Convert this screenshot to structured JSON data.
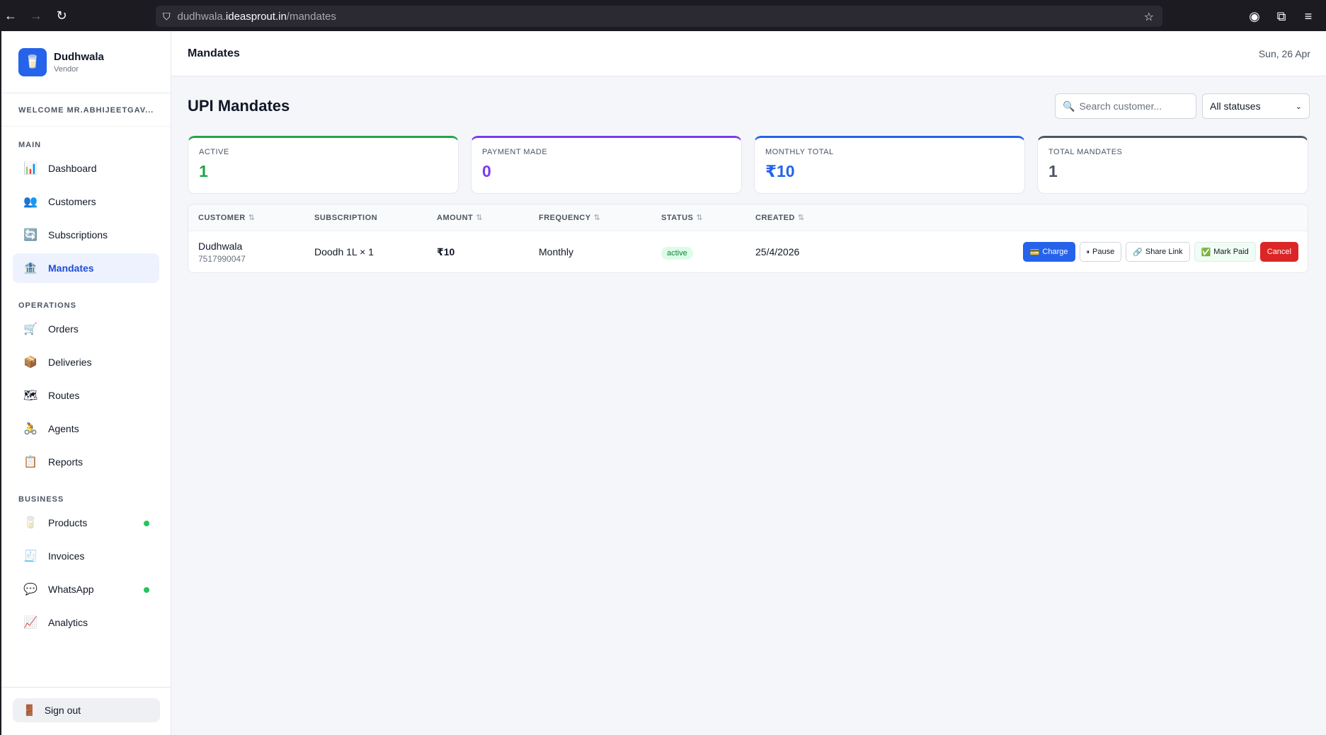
{
  "browser": {
    "url_host_prefix": "dudhwala.",
    "url_host_main": "ideasprout.in",
    "url_path": "/mandates"
  },
  "sidebar": {
    "brand_name": "Dudhwala",
    "brand_role": "Vendor",
    "welcome": "WELCOME MR.ABHIJEETGAV...",
    "sections": {
      "main": "MAIN",
      "operations": "OPERATIONS",
      "business": "BUSINESS"
    },
    "main_items": [
      {
        "label": "Dashboard",
        "icon": "📊"
      },
      {
        "label": "Customers",
        "icon": "👥"
      },
      {
        "label": "Subscriptions",
        "icon": "🔄"
      },
      {
        "label": "Mandates",
        "icon": "🏦"
      }
    ],
    "operations_items": [
      {
        "label": "Orders",
        "icon": "🛒"
      },
      {
        "label": "Deliveries",
        "icon": "📦"
      },
      {
        "label": "Routes",
        "icon": "🗺"
      },
      {
        "label": "Agents",
        "icon": "🚴"
      },
      {
        "label": "Reports",
        "icon": "📋"
      }
    ],
    "business_items": [
      {
        "label": "Products",
        "icon": "🥛"
      },
      {
        "label": "Invoices",
        "icon": "🧾"
      },
      {
        "label": "WhatsApp",
        "icon": "💬"
      },
      {
        "label": "Analytics",
        "icon": "📈"
      }
    ],
    "signout": "Sign out"
  },
  "topbar": {
    "title": "Mandates",
    "date": "Sun, 26 Apr"
  },
  "page": {
    "title": "UPI Mandates",
    "search_placeholder": "Search customer...",
    "status_filter": "All statuses"
  },
  "stats": [
    {
      "label": "ACTIVE",
      "value": "1",
      "color": "#22a34a"
    },
    {
      "label": "PAYMENT MADE",
      "value": "0",
      "color": "#7c3aed"
    },
    {
      "label": "MONTHLY TOTAL",
      "value": "₹10",
      "color": "#2563eb"
    },
    {
      "label": "TOTAL MANDATES",
      "value": "1",
      "color": "#4b5563"
    }
  ],
  "table": {
    "columns": [
      "CUSTOMER",
      "SUBSCRIPTION",
      "AMOUNT",
      "FREQUENCY",
      "STATUS",
      "CREATED"
    ],
    "rows": [
      {
        "customer": "Dudhwala",
        "phone": "7517990047",
        "subscription": "Doodh 1L × 1",
        "amount": "₹10",
        "frequency": "Monthly",
        "status": "active",
        "created": "25/4/2026"
      }
    ],
    "actions": {
      "charge": "Charge",
      "pause": "Pause",
      "share": "Share Link",
      "mark_paid": "Mark Paid",
      "cancel": "Cancel"
    }
  }
}
